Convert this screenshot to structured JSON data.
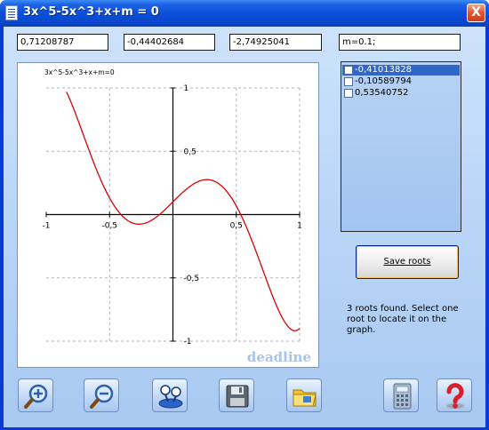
{
  "window": {
    "title": "3x^5-5x^3+x+m = 0",
    "close_label": "X"
  },
  "fields": {
    "value1": "0,71208787",
    "value2": "-0,44402684",
    "value3": "-2,74925041",
    "parameter": "m=0.1;"
  },
  "roots_list": [
    {
      "label": "-0,41013828",
      "selected": true,
      "checked": false
    },
    {
      "label": "-0,10589794",
      "selected": false,
      "checked": false
    },
    {
      "label": "0,53540752",
      "selected": false,
      "checked": false
    }
  ],
  "save_button": {
    "label": "Save roots"
  },
  "status_text": "3 roots found. Select one root to locate it on the graph.",
  "watermark": "deadline",
  "toolbar": {
    "zoom_in": "zoom-in-icon",
    "zoom_out": "zoom-out-icon",
    "tree": "network-icon",
    "save": "floppy-disk-icon",
    "open": "open-folder-icon",
    "calc": "calculator-icon",
    "help": "help-icon"
  },
  "chart_data": {
    "type": "line",
    "title": "3x^5-5x^3+x+m=0",
    "xlabel": "",
    "ylabel": "",
    "xlim": [
      -1,
      1
    ],
    "ylim": [
      -1,
      1
    ],
    "x_ticks": [
      "-1",
      "-0,5",
      "0,5",
      "1"
    ],
    "y_ticks": [
      "1",
      "0,5",
      "-0,5",
      "-1"
    ],
    "grid": true,
    "series": [
      {
        "function": "3x^5-5x^3+x+0.1",
        "x_range": [
          -0.84,
          1.0
        ],
        "color": "#e00000"
      }
    ]
  }
}
